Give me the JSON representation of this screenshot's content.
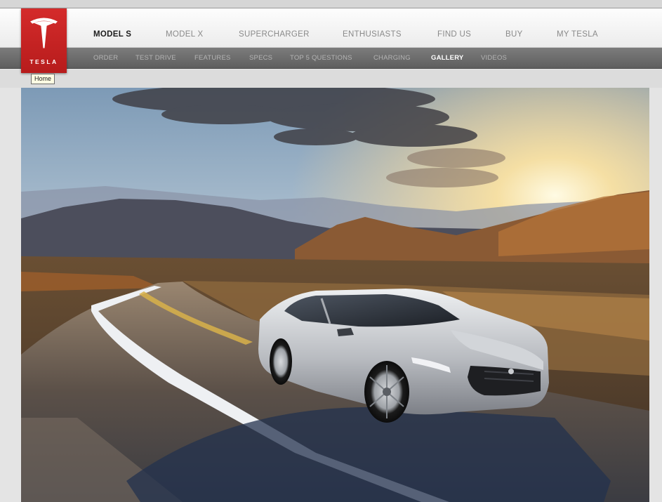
{
  "logo": {
    "text": "TESLA",
    "icon": "tesla-t-logo-icon",
    "tooltip": "Home"
  },
  "main_nav": [
    {
      "label": "MODEL S",
      "active": true
    },
    {
      "label": "MODEL X",
      "active": false
    },
    {
      "label": "SUPERCHARGER",
      "active": false
    },
    {
      "label": "ENTHUSIASTS",
      "active": false
    },
    {
      "label": "FIND US",
      "active": false
    },
    {
      "label": "BUY",
      "active": false
    },
    {
      "label": "MY TESLA",
      "active": false
    }
  ],
  "sub_nav": [
    {
      "label": "ORDER",
      "active": false
    },
    {
      "label": "TEST DRIVE",
      "active": false
    },
    {
      "label": "FEATURES",
      "active": false
    },
    {
      "label": "SPECS",
      "active": false
    },
    {
      "label": "TOP 5 QUESTIONS",
      "active": false
    },
    {
      "label": "CHARGING",
      "active": false
    },
    {
      "label": "GALLERY",
      "active": true
    },
    {
      "label": "VIDEOS",
      "active": false
    }
  ],
  "hero": {
    "image": "silver-sedan-on-mountain-road-at-sunset"
  },
  "colors": {
    "brand_red": "#c62323",
    "nav_active": "#1c1c1c",
    "nav_inactive": "#8a8a8a",
    "subnav_bg": "#6b6b6b",
    "subnav_active": "#ffffff"
  }
}
